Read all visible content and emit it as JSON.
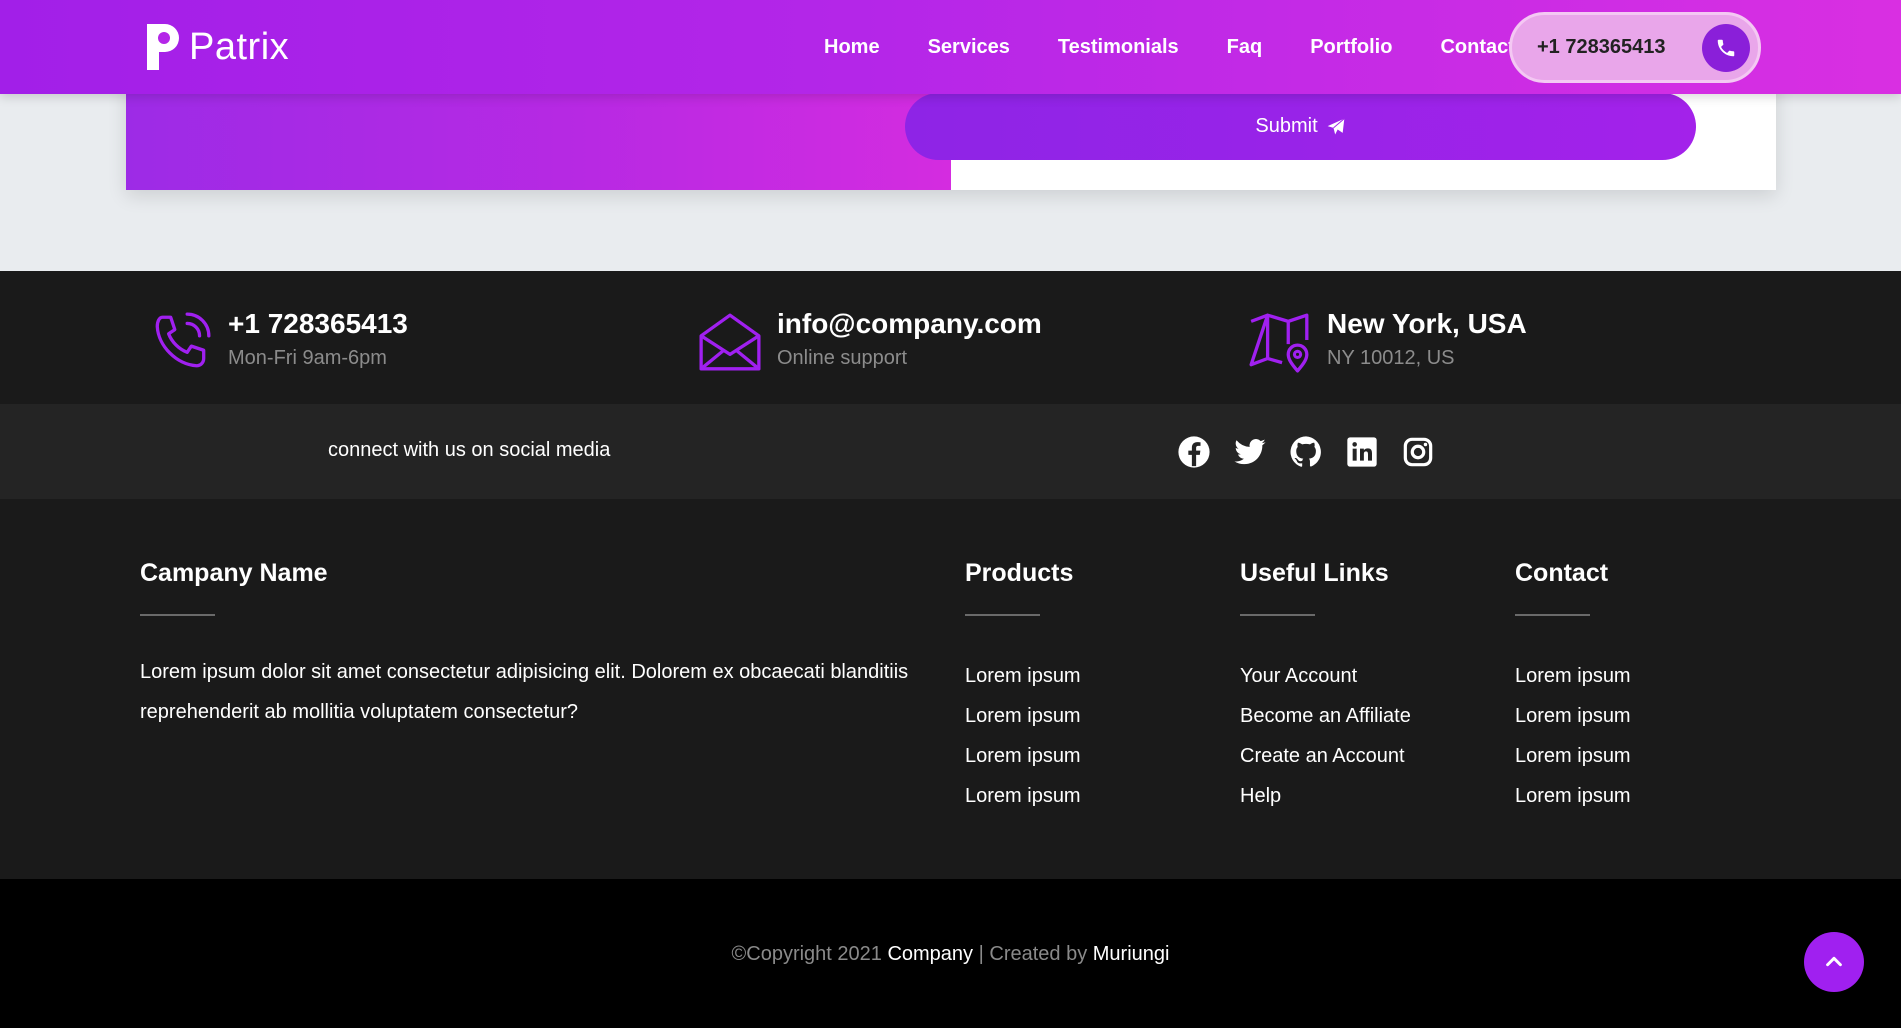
{
  "brand": {
    "name": "Patrix"
  },
  "nav": {
    "links": [
      "Home",
      "Services",
      "Testimonials",
      "Faq",
      "Portfolio",
      "Contact"
    ],
    "phone": "+1 728365413"
  },
  "form": {
    "submit_label": "Submit"
  },
  "info": {
    "phone": {
      "title": "+1 728365413",
      "sub": "Mon-Fri 9am-6pm",
      "icon": "phone-icon"
    },
    "email": {
      "title": "info@company.com",
      "sub": "Online support",
      "icon": "envelope-icon"
    },
    "location": {
      "title": "New York, USA",
      "sub": "NY 10012, US",
      "icon": "map-icon"
    }
  },
  "social": {
    "text": "connect with us on social media",
    "icons": [
      "facebook-icon",
      "twitter-icon",
      "github-icon",
      "linkedin-icon",
      "instagram-icon"
    ]
  },
  "footer": {
    "company": {
      "heading": "Campany Name",
      "description": "Lorem ipsum dolor sit amet consectetur adipisicing elit. Dolorem ex obcaecati blanditiis reprehenderit ab mollitia voluptatem consectetur?"
    },
    "products": {
      "heading": "Products",
      "items": [
        "Lorem ipsum",
        "Lorem ipsum",
        "Lorem ipsum",
        "Lorem ipsum"
      ]
    },
    "useful_links": {
      "heading": "Useful Links",
      "items": [
        "Your Account",
        "Become an Affiliate",
        "Create an Account",
        "Help"
      ]
    },
    "contact": {
      "heading": "Contact",
      "items": [
        "Lorem ipsum",
        "Lorem ipsum",
        "Lorem ipsum",
        "Lorem ipsum"
      ]
    }
  },
  "copyright": {
    "prefix": "©Copyright 2021 ",
    "company": "Company",
    "middle": " | Created by ",
    "author": "Muriungi"
  },
  "colors": {
    "accent": "#a020f0",
    "footer_bg": "#1a1a1a",
    "social_bg": "#242424",
    "copyright_bg": "#000000"
  }
}
